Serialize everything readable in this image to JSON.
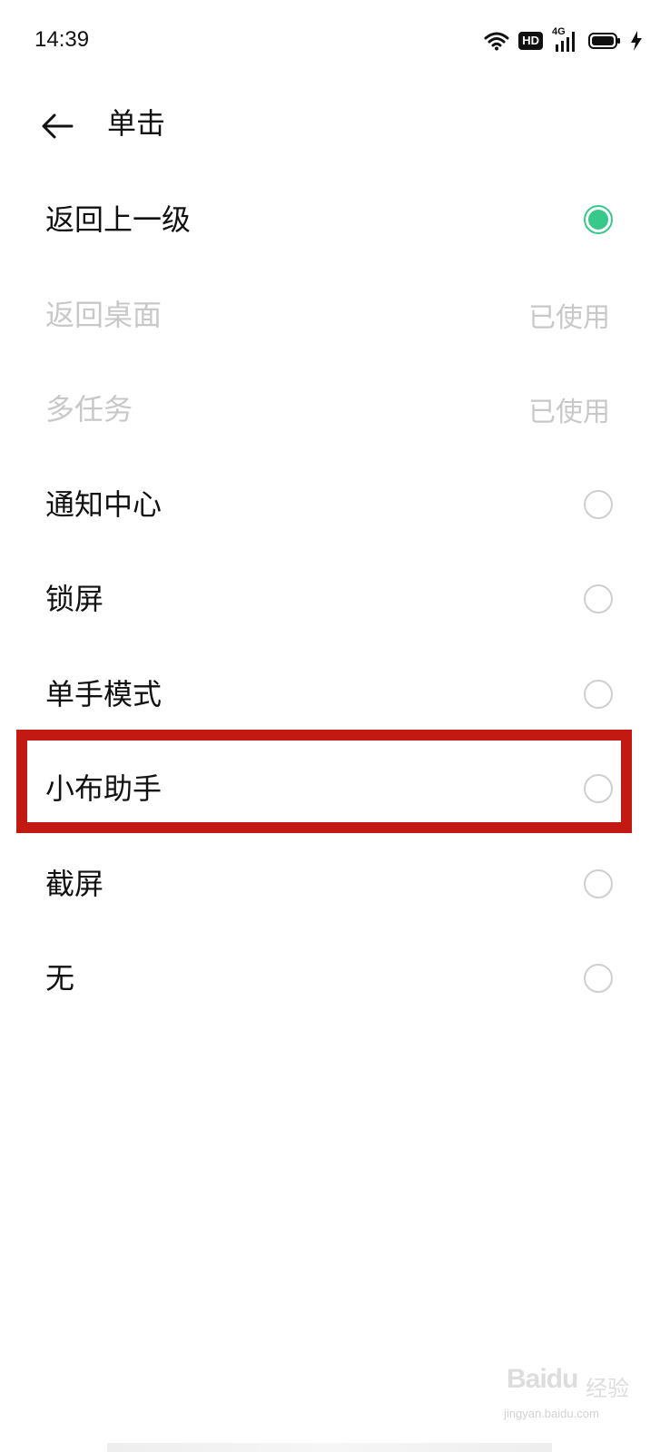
{
  "status_bar": {
    "time": "14:39",
    "icons": [
      "wifi-icon",
      "hd-icon",
      "signal-4g-icon",
      "battery-icon",
      "charging-icon"
    ],
    "hd_label": "HD",
    "network_label": "4G"
  },
  "header": {
    "back_icon": "arrow-left-icon",
    "title": "单击"
  },
  "options": [
    {
      "label": "返回上一级",
      "state": "selected"
    },
    {
      "label": "返回桌面",
      "state": "used",
      "status": "已使用"
    },
    {
      "label": "多任务",
      "state": "used",
      "status": "已使用"
    },
    {
      "label": "通知中心",
      "state": "unselected"
    },
    {
      "label": "锁屏",
      "state": "unselected"
    },
    {
      "label": "单手模式",
      "state": "unselected"
    },
    {
      "label": "小布助手",
      "state": "unselected"
    },
    {
      "label": "截屏",
      "state": "unselected"
    },
    {
      "label": "无",
      "state": "unselected"
    }
  ],
  "watermark": {
    "brand": "Baidu",
    "suffix": "经验",
    "url": "jingyan.baidu.com"
  },
  "colors": {
    "accent": "#37c98a",
    "highlight": "#c21a12",
    "disabled_text": "#c8c8c8"
  }
}
